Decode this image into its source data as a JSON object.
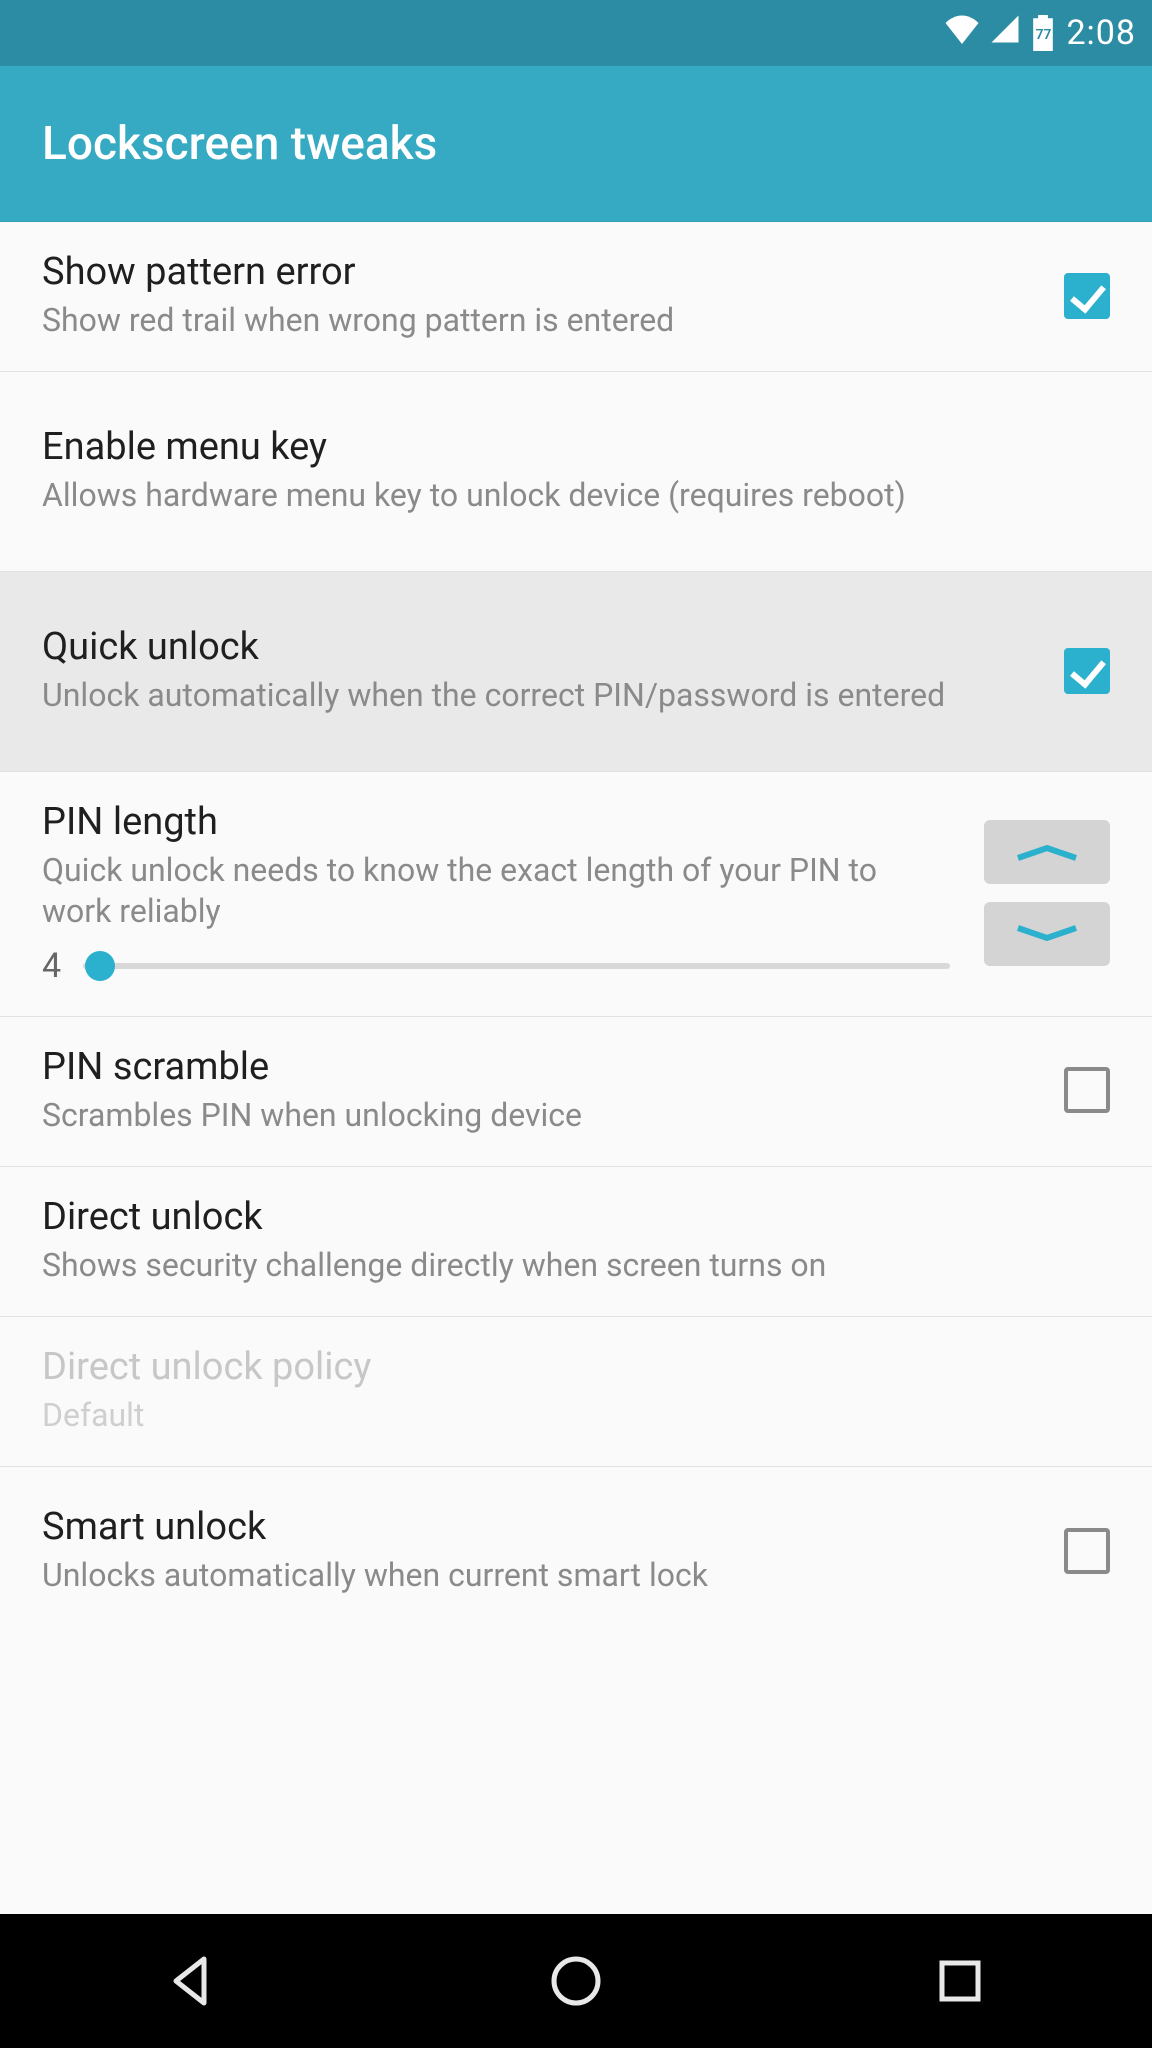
{
  "status": {
    "battery_pct": "77",
    "clock": "2:08"
  },
  "appbar": {
    "title": "Lockscreen tweaks"
  },
  "settings": {
    "show_pattern_error": {
      "title": "Show pattern error",
      "sub": "Show red trail when wrong pattern is entered",
      "checked": true
    },
    "enable_menu_key": {
      "title": "Enable menu key",
      "sub": "Allows hardware menu key to unlock device (requires reboot)"
    },
    "quick_unlock": {
      "title": "Quick unlock",
      "sub": "Unlock automatically when the correct PIN/password is entered",
      "checked": true
    },
    "pin_length": {
      "title": "PIN length",
      "sub": "Quick unlock needs to know the exact length of your PIN to work reliably",
      "value": "4",
      "min": 4,
      "max": 16,
      "slider_pct": 2
    },
    "pin_scramble": {
      "title": "PIN scramble",
      "sub": "Scrambles PIN when unlocking device",
      "checked": false
    },
    "direct_unlock": {
      "title": "Direct unlock",
      "sub": "Shows security challenge directly when screen turns on"
    },
    "direct_unlock_policy": {
      "title": "Direct unlock policy",
      "sub": "Default"
    },
    "smart_unlock": {
      "title": "Smart unlock",
      "sub": "Unlocks automatically when current smart lock",
      "checked": false
    }
  }
}
